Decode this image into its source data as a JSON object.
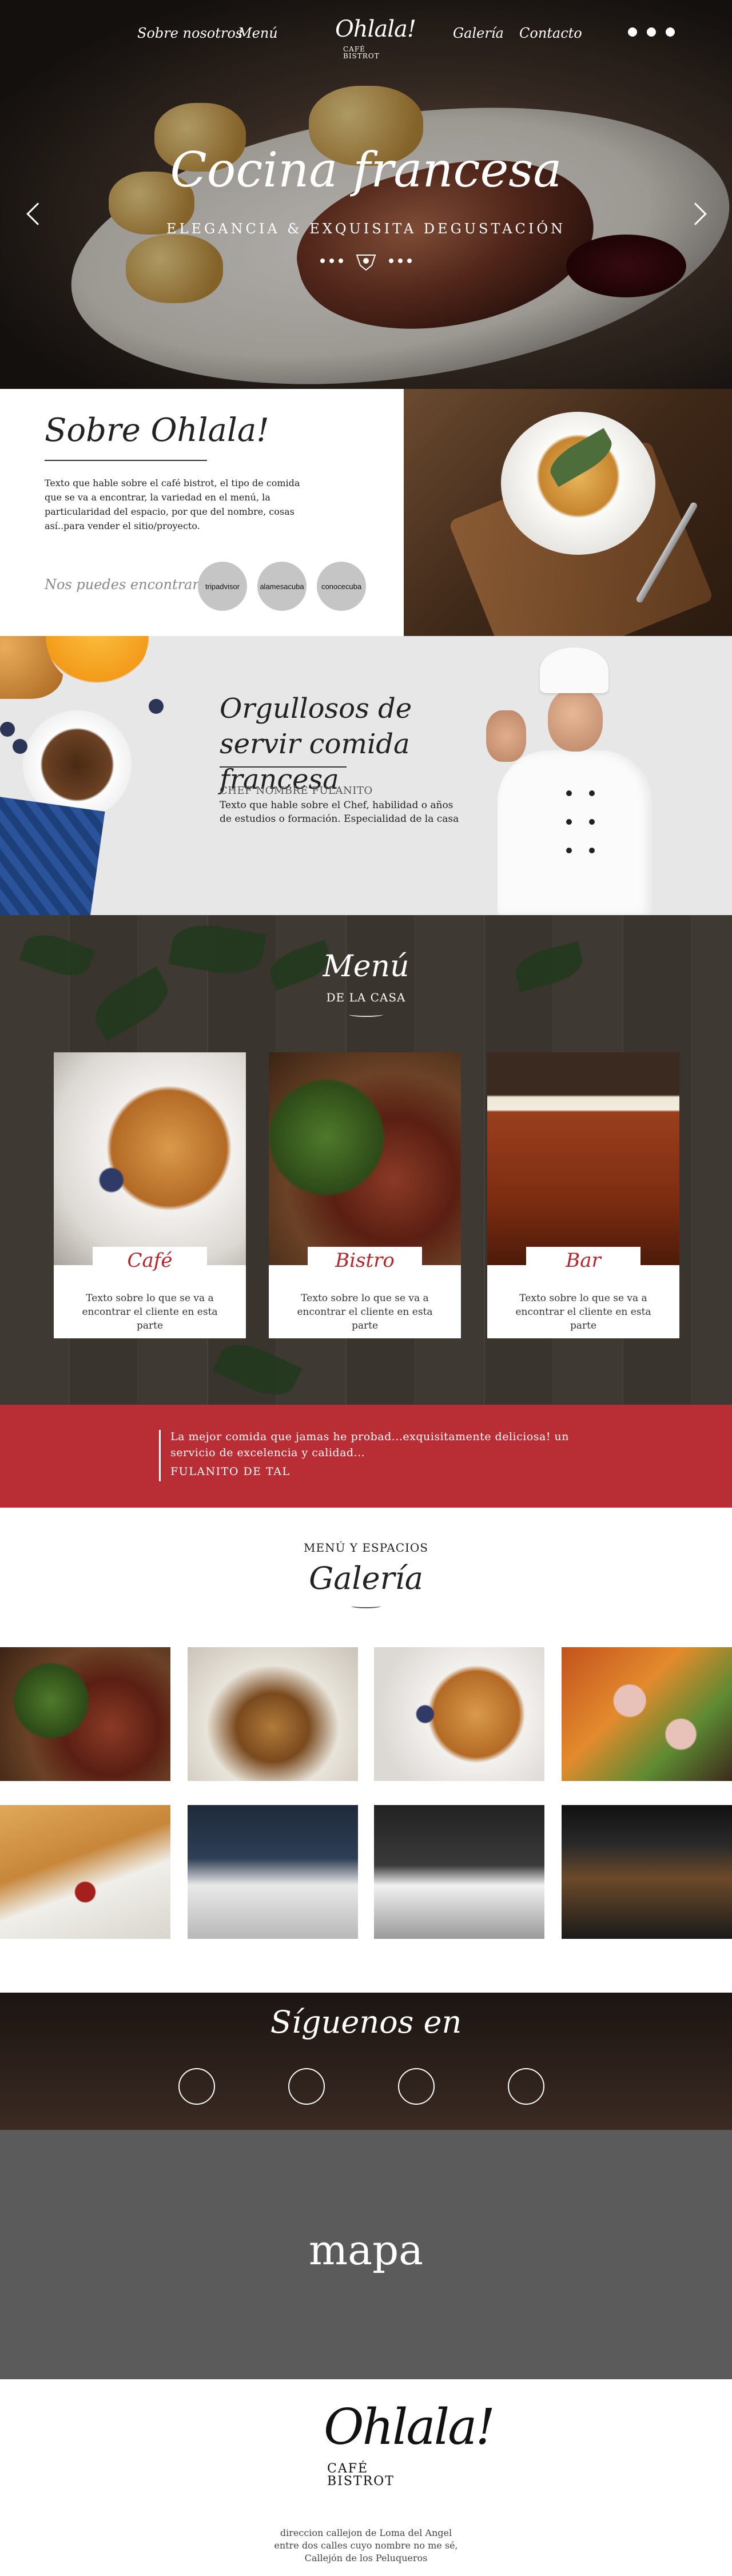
{
  "nav": {
    "items": [
      "Sobre nosotros",
      "Menú",
      "Galería",
      "Contacto"
    ]
  },
  "logo": {
    "main": "Ohlala!",
    "line1": "CAFÉ",
    "line2": "BISTROT"
  },
  "hero": {
    "title": "Cocina francesa",
    "subtitle": "ELEGANCIA & EXQUISITA DEGUSTACIÓN"
  },
  "about": {
    "title": "Sobre Ohlala!",
    "text": "Texto que hable sobre el café bistrot, el tipo de comida que se va a encontrar, la variedad en el menú, la particularidad del espacio, por que del nombre, cosas así..para vender el sitio/proyecto.",
    "find_label": "Nos puedes encontrar en",
    "badges": [
      "tripadvisor",
      "alamesacuba",
      "conocecuba"
    ]
  },
  "chef": {
    "title": "Orgullosos de servir comida francesa",
    "label": "CHEF NOMBRE FULANITO",
    "text": "Texto que hable sobre el Chef, habilidad o años de estudios o formación. Especialidad de la casa"
  },
  "menu": {
    "title": "Menú",
    "subtitle": "DE LA CASA",
    "cards": [
      {
        "name": "Café",
        "text": "Texto sobre lo que se va a encontrar el cliente en esta parte"
      },
      {
        "name": "Bistro",
        "text": "Texto sobre lo que se va a encontrar el cliente en esta parte"
      },
      {
        "name": "Bar",
        "text": "Texto sobre lo que se va a encontrar el cliente en esta parte"
      }
    ]
  },
  "quote": {
    "text": "La mejor comida que jamas he probad...exquisitamente deliciosa! un servicio de excelencia y calidad...",
    "author": "FULANITO DE TAL"
  },
  "gallery": {
    "subtitle": "MENÚ Y ESPACIOS",
    "title": "Galería"
  },
  "social": {
    "title": "Síguenos en"
  },
  "map": {
    "label": "mapa"
  },
  "footer": {
    "address": [
      "direccion callejon de Loma del Angel",
      "entre dos calles cuyo nombre no me sé,",
      "Callejón de los Peluqueros"
    ]
  },
  "colors": {
    "accent_red": "#b92e34",
    "badge_gray": "#c5c5c5",
    "map_gray": "#5b5b5b"
  }
}
